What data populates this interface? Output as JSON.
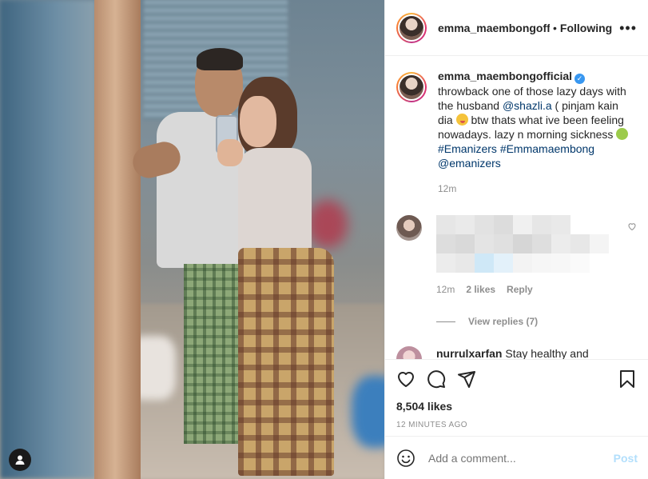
{
  "post": {
    "author": "emma_maembongofficial",
    "header_username": "emma_maembongoffi",
    "follow_state": "Following",
    "separator": "•",
    "more_menu": "•••",
    "caption": {
      "line_part1": "throwback one of those lazy days with the husband",
      "mention_husband": "@shazli.a",
      "line_part2": "( pinjam kain dia",
      "line_part3": "btw thats what ive been feeling nowadays. lazy n morning sickness",
      "hashtag1": "#Emanizers",
      "hashtag2": "#Emmamaembong",
      "mention_fan": "@emanizers",
      "time": "12m"
    },
    "comments": [
      {
        "author": "",
        "time": "12m",
        "likes": "2 likes",
        "reply": "Reply",
        "view_replies": "View replies (7)"
      },
      {
        "author": "nurrulxarfan",
        "text": "Stay healthy and"
      }
    ],
    "likes": "8,504 likes",
    "posted_ago": "12 MINUTES AGO",
    "add_comment_placeholder": "Add a comment...",
    "post_button": "Post",
    "icons": {
      "like": "heart-icon",
      "comment": "comment-icon",
      "share": "share-icon",
      "save": "bookmark-icon",
      "emoji": "emoji-icon",
      "user_tag": "user-tag-icon"
    },
    "colors": {
      "link": "#00376b",
      "verified": "#3897f0",
      "post_disabled": "#b2dffc",
      "muted": "#8e8e8e"
    }
  }
}
